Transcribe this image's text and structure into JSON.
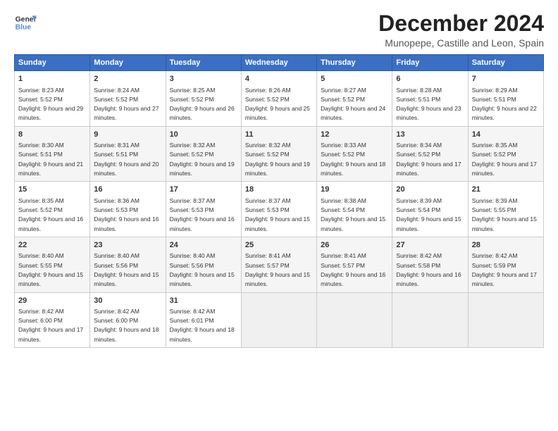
{
  "header": {
    "logo_line1": "General",
    "logo_line2": "Blue",
    "main_title": "December 2024",
    "subtitle": "Munopepe, Castille and Leon, Spain"
  },
  "columns": [
    "Sunday",
    "Monday",
    "Tuesday",
    "Wednesday",
    "Thursday",
    "Friday",
    "Saturday"
  ],
  "weeks": [
    [
      {
        "day": "1",
        "sunrise": "8:23 AM",
        "sunset": "5:52 PM",
        "daylight": "9 hours and 29 minutes."
      },
      {
        "day": "2",
        "sunrise": "8:24 AM",
        "sunset": "5:52 PM",
        "daylight": "9 hours and 27 minutes."
      },
      {
        "day": "3",
        "sunrise": "8:25 AM",
        "sunset": "5:52 PM",
        "daylight": "9 hours and 26 minutes."
      },
      {
        "day": "4",
        "sunrise": "8:26 AM",
        "sunset": "5:52 PM",
        "daylight": "9 hours and 25 minutes."
      },
      {
        "day": "5",
        "sunrise": "8:27 AM",
        "sunset": "5:52 PM",
        "daylight": "9 hours and 24 minutes."
      },
      {
        "day": "6",
        "sunrise": "8:28 AM",
        "sunset": "5:51 PM",
        "daylight": "9 hours and 23 minutes."
      },
      {
        "day": "7",
        "sunrise": "8:29 AM",
        "sunset": "5:51 PM",
        "daylight": "9 hours and 22 minutes."
      }
    ],
    [
      {
        "day": "8",
        "sunrise": "8:30 AM",
        "sunset": "5:51 PM",
        "daylight": "9 hours and 21 minutes."
      },
      {
        "day": "9",
        "sunrise": "8:31 AM",
        "sunset": "5:51 PM",
        "daylight": "9 hours and 20 minutes."
      },
      {
        "day": "10",
        "sunrise": "8:32 AM",
        "sunset": "5:52 PM",
        "daylight": "9 hours and 19 minutes."
      },
      {
        "day": "11",
        "sunrise": "8:32 AM",
        "sunset": "5:52 PM",
        "daylight": "9 hours and 19 minutes."
      },
      {
        "day": "12",
        "sunrise": "8:33 AM",
        "sunset": "5:52 PM",
        "daylight": "9 hours and 18 minutes."
      },
      {
        "day": "13",
        "sunrise": "8:34 AM",
        "sunset": "5:52 PM",
        "daylight": "9 hours and 17 minutes."
      },
      {
        "day": "14",
        "sunrise": "8:35 AM",
        "sunset": "5:52 PM",
        "daylight": "9 hours and 17 minutes."
      }
    ],
    [
      {
        "day": "15",
        "sunrise": "8:35 AM",
        "sunset": "5:52 PM",
        "daylight": "9 hours and 16 minutes."
      },
      {
        "day": "16",
        "sunrise": "8:36 AM",
        "sunset": "5:53 PM",
        "daylight": "9 hours and 16 minutes."
      },
      {
        "day": "17",
        "sunrise": "8:37 AM",
        "sunset": "5:53 PM",
        "daylight": "9 hours and 16 minutes."
      },
      {
        "day": "18",
        "sunrise": "8:37 AM",
        "sunset": "5:53 PM",
        "daylight": "9 hours and 15 minutes."
      },
      {
        "day": "19",
        "sunrise": "8:38 AM",
        "sunset": "5:54 PM",
        "daylight": "9 hours and 15 minutes."
      },
      {
        "day": "20",
        "sunrise": "8:39 AM",
        "sunset": "5:54 PM",
        "daylight": "9 hours and 15 minutes."
      },
      {
        "day": "21",
        "sunrise": "8:39 AM",
        "sunset": "5:55 PM",
        "daylight": "9 hours and 15 minutes."
      }
    ],
    [
      {
        "day": "22",
        "sunrise": "8:40 AM",
        "sunset": "5:55 PM",
        "daylight": "9 hours and 15 minutes."
      },
      {
        "day": "23",
        "sunrise": "8:40 AM",
        "sunset": "5:56 PM",
        "daylight": "9 hours and 15 minutes."
      },
      {
        "day": "24",
        "sunrise": "8:40 AM",
        "sunset": "5:56 PM",
        "daylight": "9 hours and 15 minutes."
      },
      {
        "day": "25",
        "sunrise": "8:41 AM",
        "sunset": "5:57 PM",
        "daylight": "9 hours and 15 minutes."
      },
      {
        "day": "26",
        "sunrise": "8:41 AM",
        "sunset": "5:57 PM",
        "daylight": "9 hours and 16 minutes."
      },
      {
        "day": "27",
        "sunrise": "8:42 AM",
        "sunset": "5:58 PM",
        "daylight": "9 hours and 16 minutes."
      },
      {
        "day": "28",
        "sunrise": "8:42 AM",
        "sunset": "5:59 PM",
        "daylight": "9 hours and 17 minutes."
      }
    ],
    [
      {
        "day": "29",
        "sunrise": "8:42 AM",
        "sunset": "6:00 PM",
        "daylight": "9 hours and 17 minutes."
      },
      {
        "day": "30",
        "sunrise": "8:42 AM",
        "sunset": "6:00 PM",
        "daylight": "9 hours and 18 minutes."
      },
      {
        "day": "31",
        "sunrise": "8:42 AM",
        "sunset": "6:01 PM",
        "daylight": "9 hours and 18 minutes."
      },
      null,
      null,
      null,
      null
    ]
  ]
}
